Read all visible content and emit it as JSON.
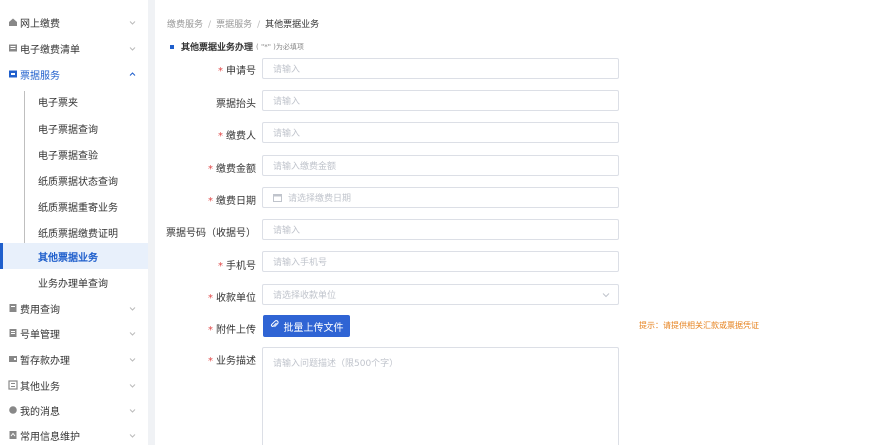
{
  "sidebar": {
    "items": [
      {
        "label": "网上缴费",
        "icon": "home-icon"
      },
      {
        "label": "电子缴费清单",
        "icon": "list-icon"
      },
      {
        "label": "票据服务",
        "icon": "ticket-icon"
      },
      {
        "label": "费用查询",
        "icon": "search-doc-icon"
      },
      {
        "label": "号单管理",
        "icon": "doc-icon"
      },
      {
        "label": "暂存款办理",
        "icon": "wallet-icon"
      },
      {
        "label": "其他业务",
        "icon": "grid-icon"
      },
      {
        "label": "我的消息",
        "icon": "message-icon"
      },
      {
        "label": "常用信息维护",
        "icon": "settings-doc-icon"
      }
    ],
    "sub_items": [
      {
        "label": "电子票夹"
      },
      {
        "label": "电子票据查询"
      },
      {
        "label": "电子票据查验"
      },
      {
        "label": "纸质票据状态查询"
      },
      {
        "label": "纸质票据重寄业务"
      },
      {
        "label": "纸质票据缴费证明"
      },
      {
        "label": "其他票据业务"
      },
      {
        "label": "业务办理单查询"
      }
    ],
    "active_sub": "其他票据业务"
  },
  "breadcrumb": {
    "items": [
      "缴费服务",
      "票据服务",
      "其他票据业务"
    ],
    "separator": "/"
  },
  "section": {
    "title": "其他票据业务办理",
    "note": "( \"*\" )为必填项"
  },
  "form": {
    "required_mark": "*",
    "fields": [
      {
        "label": "申请号",
        "required": true,
        "placeholder": "请输入"
      },
      {
        "label": "票据抬头",
        "required": false,
        "placeholder": "请输入"
      },
      {
        "label": "缴费人",
        "required": true,
        "placeholder": "请输入"
      },
      {
        "label": "缴费金额",
        "required": true,
        "placeholder": "请输入缴费金额"
      },
      {
        "label": "缴费日期",
        "required": true,
        "placeholder": "请选择缴费日期"
      },
      {
        "label": "票据号码（收据号）",
        "required": false,
        "placeholder": "请输入"
      },
      {
        "label": "手机号",
        "required": true,
        "placeholder": "请输入手机号"
      },
      {
        "label": "收款单位",
        "required": true,
        "placeholder": "请选择收款单位"
      }
    ],
    "attachment": {
      "label": "附件上传",
      "required": true,
      "button": "批量上传文件",
      "hint": "提示：请提供相关汇款或票据凭证"
    },
    "description": {
      "label": "业务描述",
      "required": true,
      "placeholder": "请输入问题描述（限500个字）"
    }
  },
  "colors": {
    "accent": "#1f5fcc",
    "required": "#e04848",
    "hint": "#e6821e",
    "active_bg": "#e8f0fb"
  }
}
